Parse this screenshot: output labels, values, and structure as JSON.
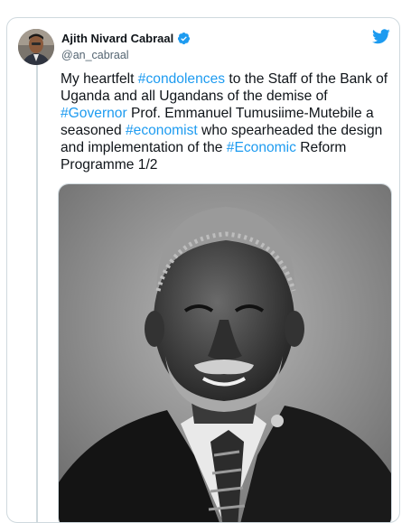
{
  "author": {
    "display_name": "Ajith Nivard Cabraal",
    "handle": "@an_cabraal"
  },
  "tweet": {
    "segments": [
      {
        "text": "My heartfelt ",
        "tag": false
      },
      {
        "text": "#condolences",
        "tag": true
      },
      {
        "text": " to the Staff of the Bank of Uganda and all Ugandans of the demise of ",
        "tag": false
      },
      {
        "text": "#Governor",
        "tag": true
      },
      {
        "text": " Prof. Emmanuel Tumusiime-Mutebile a seasoned ",
        "tag": false
      },
      {
        "text": "#economist",
        "tag": true
      },
      {
        "text": " who spearheaded the design and implementation of the ",
        "tag": false
      },
      {
        "text": "#Economic",
        "tag": true
      },
      {
        "text": " Reform Programme 1/2",
        "tag": false
      }
    ]
  },
  "icons": {
    "verified": "verified-badge-icon",
    "brand": "twitter-bird-icon"
  },
  "colors": {
    "hashtag": "#1d9bf0",
    "verified": "#1d9bf0",
    "text": "#0f1419",
    "muted": "#536471"
  }
}
